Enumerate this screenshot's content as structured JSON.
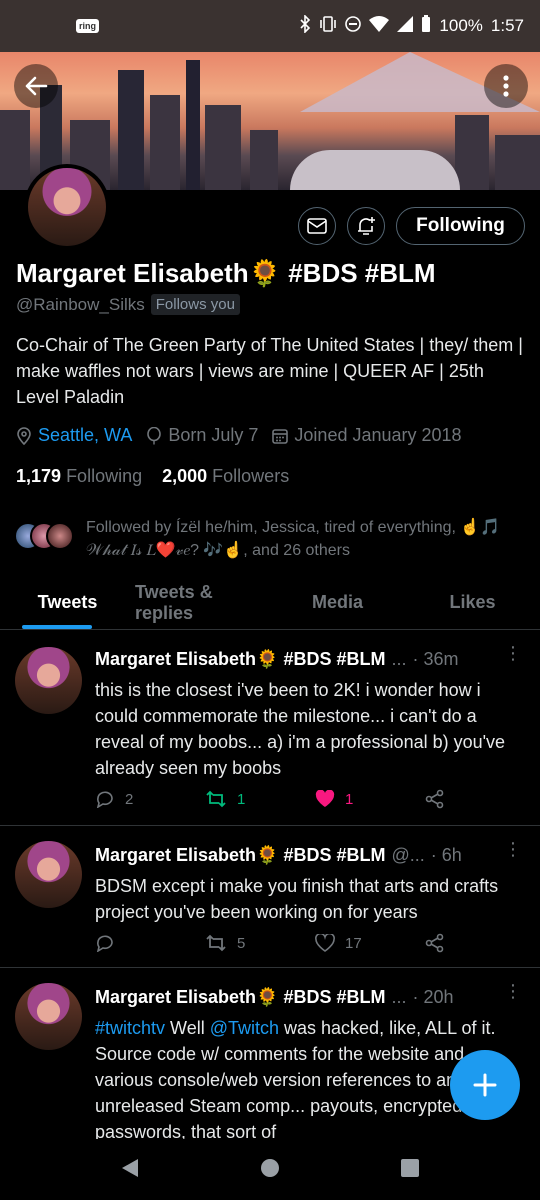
{
  "status_bar": {
    "ring_label": "ring",
    "battery": "100%",
    "time": "1:57"
  },
  "profile": {
    "name": "Margaret Elisabeth🌻 #BDS #BLM",
    "handle": "@Rainbow_Silks",
    "follows_you": "Follows you",
    "bio": "Co-Chair of The Green Party of The United States | they/ them | make waffles not wars | views are mine | QUEER AF | 25th Level Paladin",
    "location": "Seattle, WA",
    "born": "Born July 7",
    "joined": "Joined January 2018",
    "following_count": "1,179",
    "following_label": "Following",
    "followers_count": "2,000",
    "followers_label": "Followers",
    "followed_by": "Followed by Ízël he/him, Jessica, tired of everything, ☝️🎵 𝒲𝒽𝒶𝓉 𝐼𝓈 𝐿❤️𝓋𝑒? 🎶☝️, and 26 others",
    "following_button": "Following"
  },
  "tabs": [
    "Tweets",
    "Tweets & replies",
    "Media",
    "Likes"
  ],
  "active_tab": "Tweets",
  "tweets": [
    {
      "name": "Margaret Elisabeth🌻 #BDS #BLM",
      "handle": "...",
      "time": "· 36m",
      "text": "this is the closest i've been to 2K!  i wonder how i could commemorate the milestone...  i can't do a reveal of my boobs... a) i'm a professional b) you've already seen my boobs",
      "replies": "2",
      "retweets": "1",
      "likes": "1"
    },
    {
      "name": "Margaret Elisabeth🌻 #BDS #BLM",
      "handle": "@...",
      "time": "· 6h",
      "text": "BDSM except i make you finish that arts and crafts project you've been working on for years",
      "replies": "",
      "retweets": "5",
      "likes": "17"
    },
    {
      "name": "Margaret Elisabeth🌻 #BDS #BLM",
      "handle": "...",
      "time": "· 20h",
      "hashtag": "#twitchtv",
      "text_a": " Well ",
      "mention": "@Twitch",
      "text_b": " was hacked, like, ALL of it.  Source code w/ comments for the website and various console/web version references to an unreleased Steam comp... payouts, encrypted passwords, that sort of"
    }
  ],
  "colors": {
    "accent": "#1d9bf0",
    "retweet": "#00ba7c",
    "like": "#f91880",
    "muted": "#71767b"
  }
}
